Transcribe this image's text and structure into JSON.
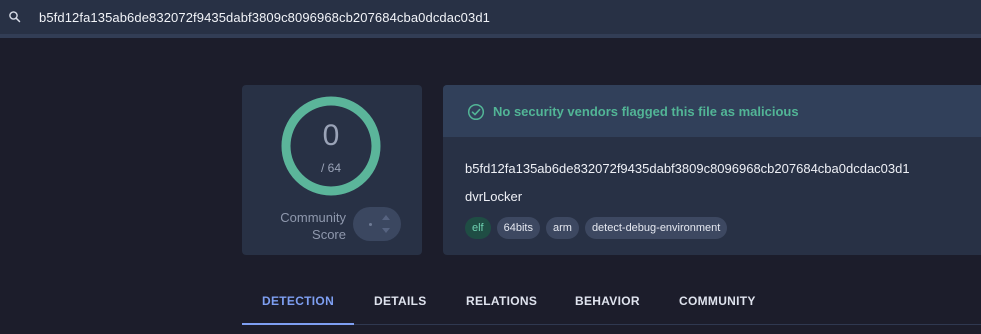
{
  "search": {
    "icon": "search-icon",
    "value": "b5fd12fa135ab6de832072f9435dabf3809c8096968cb207684cba0dcdac03d1"
  },
  "score": {
    "detections": "0",
    "total": "/ 64",
    "ring_fraction": 1.0,
    "ring_color": "#5bb59a",
    "community_label_line1": "Community",
    "community_label_line2": "Score"
  },
  "verdict": {
    "icon": "check-circle-icon",
    "text": "No security vendors flagged this file as malicious",
    "color": "#52b596"
  },
  "file": {
    "hash": "b5fd12fa135ab6de832072f9435dabf3809c8096968cb207684cba0dcdac03d1",
    "name": "dvrLocker",
    "tags": [
      "elf",
      "64bits",
      "arm",
      "detect-debug-environment"
    ]
  },
  "tabs": [
    {
      "label": "DETECTION",
      "active": true
    },
    {
      "label": "DETAILS",
      "active": false
    },
    {
      "label": "RELATIONS",
      "active": false
    },
    {
      "label": "BEHAVIOR",
      "active": false
    },
    {
      "label": "COMMUNITY",
      "active": false
    }
  ],
  "colors": {
    "accent": "#7e9ff2",
    "background": "#1c1d2b",
    "card": "#283145"
  }
}
